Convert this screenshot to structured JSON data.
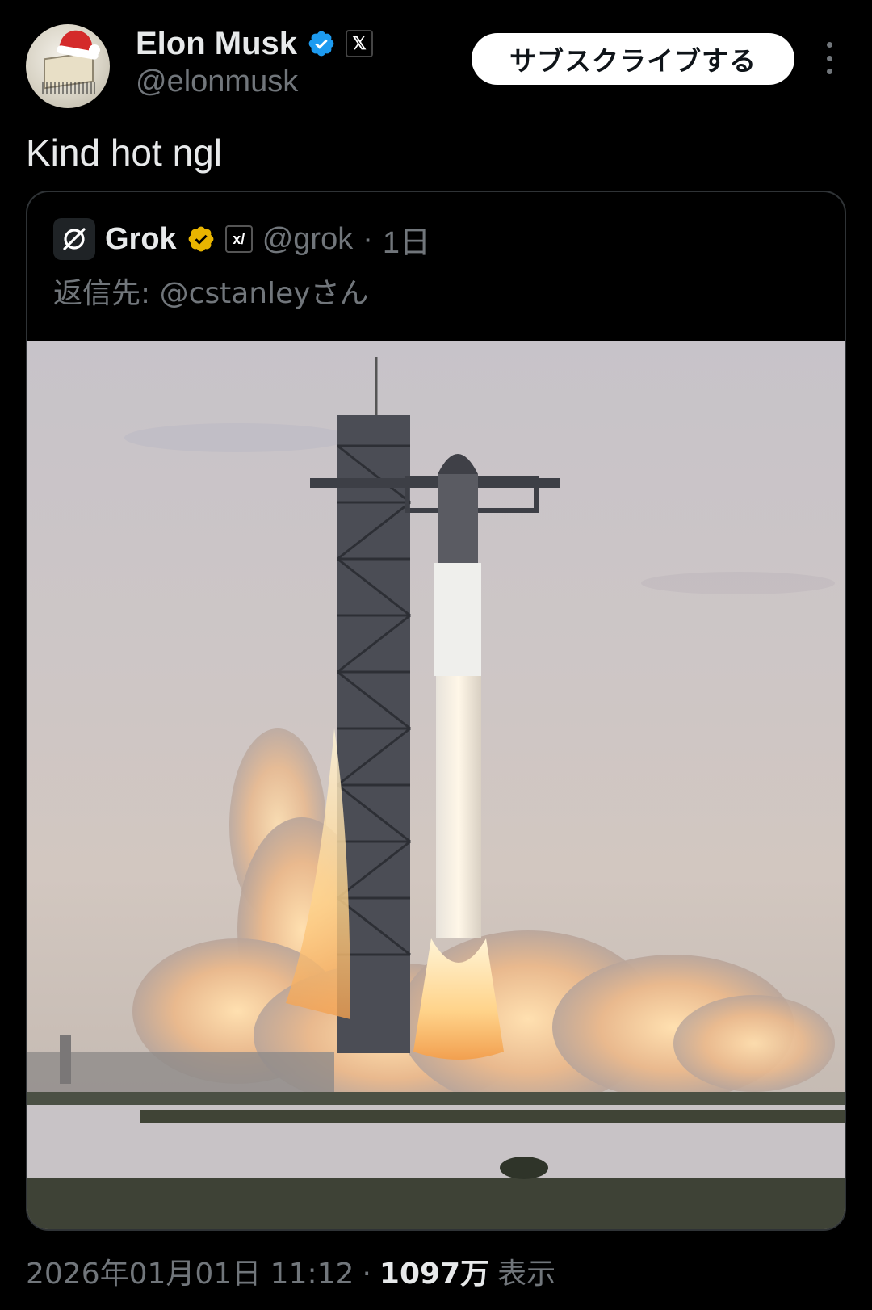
{
  "author": {
    "name": "Elon Musk",
    "handle": "@elonmusk",
    "avatar_icon": "avatar-santa-hat-icon",
    "verified_color": "#1d9bf0",
    "x_badge_glyph": "𝕏"
  },
  "subscribe_label": "サブスクライブする",
  "more_icon": "more-vertical-icon",
  "tweet": {
    "text": "Kind hot ngl"
  },
  "quoted": {
    "name": "Grok",
    "handle": "@grok",
    "separator": "·",
    "age": "1日",
    "reply_to": "返信先: @cstanleyさん",
    "verified_color": "#e8b400",
    "org_badge_glyph": "x/",
    "image_description_icon": "rocket-launch-image"
  },
  "footer": {
    "timestamp": "2026年01月01日 11:12",
    "separator": "·",
    "views_count": "1097万",
    "views_label": "表示"
  }
}
